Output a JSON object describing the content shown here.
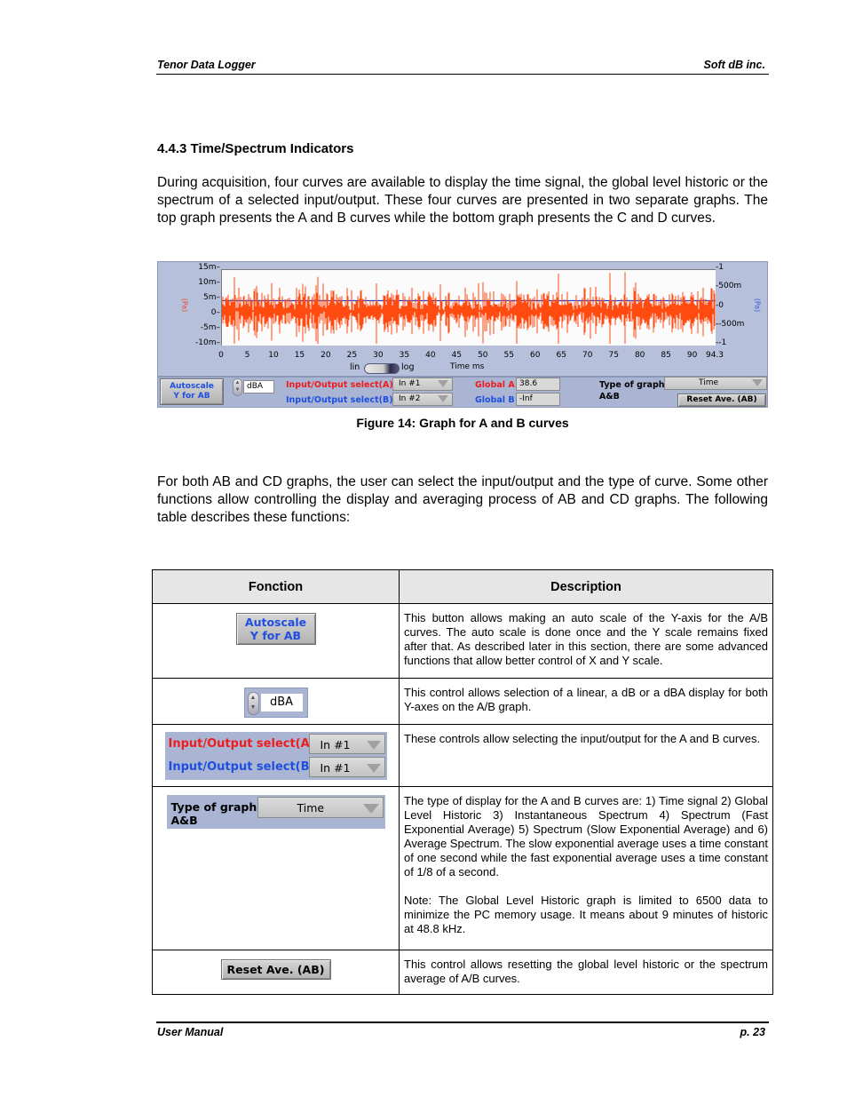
{
  "header": {
    "left": "Tenor Data Logger",
    "right": "Soft dB inc."
  },
  "section": {
    "title": "4.4.3 Time/Spectrum Indicators",
    "intro": "During acquisition, four curves are available to display the time signal, the global level historic or the spectrum of a selected input/output. These four curves are presented in two separate graphs. The top graph presents the A and B curves while the bottom graph presents the C and D curves."
  },
  "figure": {
    "caption": "Figure 14: Graph for A and B curves",
    "graph": {
      "left_axis_label": "(Pa)",
      "right_axis_label": "(Pa)",
      "left_ticks": [
        "15m",
        "10m",
        "5m",
        "0",
        "-5m",
        "-10m"
      ],
      "right_ticks": [
        "1",
        "500m",
        "0",
        "-500m",
        "-1"
      ],
      "x_ticks": [
        "0",
        "5",
        "10",
        "15",
        "20",
        "25",
        "30",
        "35",
        "40",
        "45",
        "50",
        "55",
        "60",
        "65",
        "70",
        "75",
        "80",
        "85",
        "90",
        "94.3"
      ],
      "x_label": "Time ms",
      "scale_toggle": {
        "left": "lin",
        "right": "log",
        "state": "lin"
      },
      "colors": {
        "curve_a": "#ff4a10",
        "curve_b": "#1f3fd0",
        "plot_bg": "#fbfbfb",
        "panel_bg": "#b6c0db"
      }
    },
    "controls": {
      "autoscale_button": "Autoscale\nY for AB",
      "autoscale_line1": "Autoscale",
      "autoscale_line2": "Y for AB",
      "y_units": "dBA",
      "io_select_a_label": "Input/Output select(A)",
      "io_select_a_value": "In #1",
      "io_select_b_label": "Input/Output select(B)",
      "io_select_b_value": "In #2",
      "global_a_label": "Global A",
      "global_a_value": "38.6",
      "global_b_label": "Global B",
      "global_b_value": "-Inf",
      "type_of_graph_label_1": "Type of graph",
      "type_of_graph_label_2": "A&B",
      "type_of_graph_value": "Time",
      "reset_button": "Reset  Ave. (AB)"
    }
  },
  "paragraph2": "For both AB and CD graphs, the user can select the input/output and the type of curve. Some other functions allow controlling the display and averaging process of AB and CD graphs. The following table describes these functions:",
  "table": {
    "headers": [
      "Fonction",
      "Description"
    ],
    "rows": [
      {
        "control": {
          "line1": "Autoscale",
          "line2": "Y for AB"
        },
        "description": [
          "This button allows making an auto scale of the Y-axis for the A/B curves. The auto scale is done once and the Y scale remains fixed after that. As described later in this section, there are some advanced functions that allow better control of X and Y scale."
        ]
      },
      {
        "control": {
          "value": "dBA"
        },
        "description": [
          "This control allows selection of a linear, a dB or a dBA display for both Y-axes on the A/B graph."
        ]
      },
      {
        "control": {
          "label_a": "Input/Output select(A)",
          "value_a": "In #1",
          "label_b": "Input/Output select(B)",
          "value_b": "In #1"
        },
        "description": [
          "These controls allow selecting the input/output for the A and B curves."
        ]
      },
      {
        "control": {
          "label1": "Type of graph",
          "label2": "A&B",
          "value": "Time"
        },
        "description": [
          "The type of display for the A and B curves are: 1) Time signal 2) Global Level Historic 3) Instantaneous Spectrum 4) Spectrum (Fast Exponential Average) 5) Spectrum (Slow Exponential Average) and 6) Average Spectrum. The slow exponential average uses a time constant of one second while the fast exponential average uses a time constant of 1/8 of a second.",
          "Note: The Global Level Historic graph is limited to 6500 data to minimize the PC memory usage. It means about 9 minutes of historic at 48.8 kHz."
        ]
      },
      {
        "control": {
          "label": "Reset  Ave. (AB)"
        },
        "description": [
          "This control allows resetting the global level historic or the spectrum average of A/B curves."
        ]
      }
    ]
  },
  "footer": {
    "left": "User Manual",
    "right": "p. 23"
  }
}
